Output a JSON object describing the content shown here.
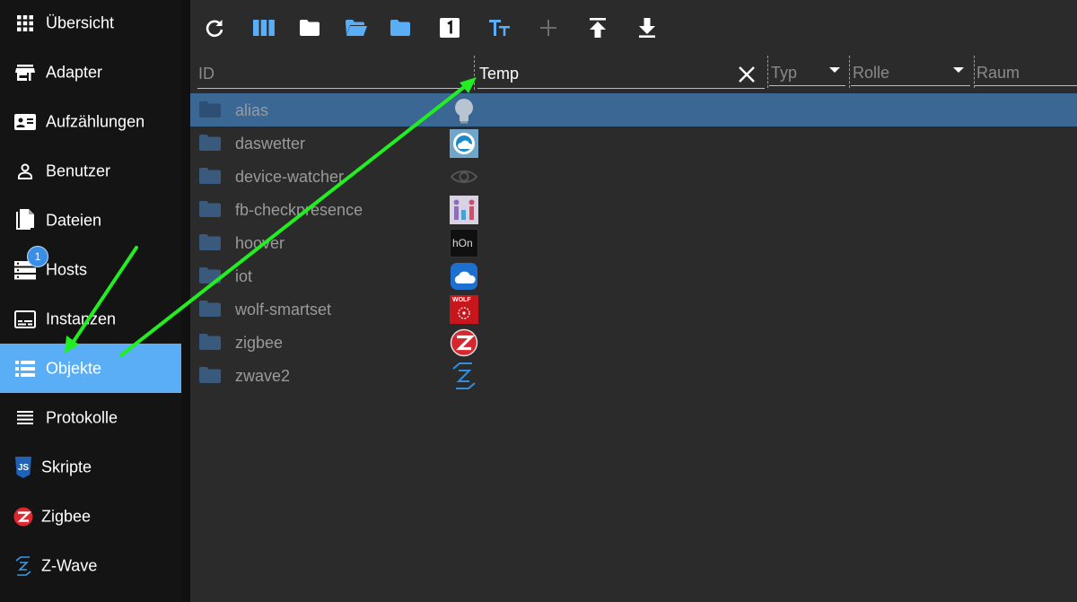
{
  "sidebar": {
    "items": [
      {
        "label": "Übersicht",
        "icon": "grid-icon"
      },
      {
        "label": "Adapter",
        "icon": "store-icon"
      },
      {
        "label": "Aufzählungen",
        "icon": "list-card-icon"
      },
      {
        "label": "Benutzer",
        "icon": "person-icon"
      },
      {
        "label": "Dateien",
        "icon": "files-icon"
      },
      {
        "label": "Hosts",
        "icon": "server-icon",
        "badge": "1"
      },
      {
        "label": "Instanzen",
        "icon": "instances-icon"
      },
      {
        "label": "Objekte",
        "icon": "objects-list-icon",
        "active": true
      },
      {
        "label": "Protokolle",
        "icon": "lines-icon"
      },
      {
        "label": "Skripte",
        "icon": "js-icon"
      },
      {
        "label": "Zigbee",
        "icon": "zigbee-icon"
      },
      {
        "label": "Z-Wave",
        "icon": "zwave-icon"
      }
    ]
  },
  "toolbar": {
    "buttons": [
      "refresh-icon",
      "columns-icon",
      "folder-icon",
      "folder-open-icon",
      "folder-closed-icon",
      "number-one-icon",
      "text-size-icon",
      "add-icon",
      "upload-icon",
      "download-icon"
    ]
  },
  "filters": {
    "id_label": "ID",
    "name_value": "Temp",
    "type_label": "Typ",
    "role_label": "Rolle",
    "room_label": "Raum"
  },
  "rows": [
    {
      "name": "alias",
      "icon": "lightbulb-icon",
      "selected": true
    },
    {
      "name": "daswetter",
      "icon": "daswetter-icon"
    },
    {
      "name": "device-watcher",
      "icon": "eye-icon"
    },
    {
      "name": "fb-checkpresence",
      "icon": "fb-checkpresence-icon"
    },
    {
      "name": "hoover",
      "icon": "hoover-icon",
      "icon_text": "hOn"
    },
    {
      "name": "iot",
      "icon": "cloud-icon"
    },
    {
      "name": "wolf-smartset",
      "icon": "wolf-icon",
      "icon_text": "WOLF"
    },
    {
      "name": "zigbee",
      "icon": "zigbee-icon"
    },
    {
      "name": "zwave2",
      "icon": "zwave-icon"
    }
  ],
  "colors": {
    "accent": "#5aaef5",
    "selected_row": "#3b6794",
    "annotation_arrow": "#22ee22"
  }
}
